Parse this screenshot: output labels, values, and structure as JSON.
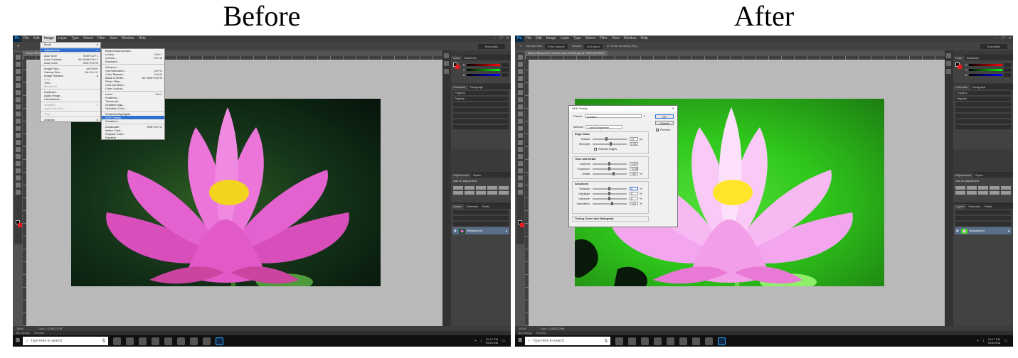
{
  "captions": {
    "before": "Before",
    "after": "After"
  },
  "app": {
    "logo": "Ps",
    "menus": [
      "File",
      "Edit",
      "Image",
      "Layer",
      "Type",
      "Select",
      "Filter",
      "View",
      "Window",
      "Help"
    ],
    "window_controls": [
      "–",
      "☐",
      "✕"
    ]
  },
  "before": {
    "doc_tab": "Banyo Banyo Arti",
    "options": {
      "workspace": "Essentials"
    },
    "image_menu": [
      {
        "label": "Mode",
        "submenu": true
      },
      {
        "sep": true
      },
      {
        "label": "Adjustments",
        "submenu": true,
        "highlight": true
      },
      {
        "sep": true
      },
      {
        "label": "Auto Tone",
        "shortcut": "Shift+Ctrl+L"
      },
      {
        "label": "Auto Contrast",
        "shortcut": "Alt+Shift+Ctrl+L"
      },
      {
        "label": "Auto Color",
        "shortcut": "Shift+Ctrl+B"
      },
      {
        "sep": true
      },
      {
        "label": "Image Size...",
        "shortcut": "Alt+Ctrl+I"
      },
      {
        "label": "Canvas Size...",
        "shortcut": "Alt+Ctrl+C"
      },
      {
        "label": "Image Rotation",
        "submenu": true
      },
      {
        "label": "Crop",
        "disabled": true
      },
      {
        "label": "Trim..."
      },
      {
        "label": "Reveal All",
        "disabled": true
      },
      {
        "sep": true
      },
      {
        "label": "Duplicate..."
      },
      {
        "label": "Apply Image..."
      },
      {
        "label": "Calculations..."
      },
      {
        "sep": true
      },
      {
        "label": "Variables",
        "submenu": true,
        "disabled": true
      },
      {
        "label": "Apply Data Set...",
        "disabled": true
      },
      {
        "sep": true
      },
      {
        "label": "Trap...",
        "disabled": true
      },
      {
        "sep": true
      },
      {
        "label": "Analysis",
        "submenu": true
      }
    ],
    "adjust_menu": [
      {
        "label": "Brightness/Contrast..."
      },
      {
        "label": "Levels...",
        "shortcut": "Ctrl+L"
      },
      {
        "label": "Curves...",
        "shortcut": "Ctrl+M"
      },
      {
        "label": "Exposure..."
      },
      {
        "sep": true
      },
      {
        "label": "Vibrance..."
      },
      {
        "label": "Hue/Saturation...",
        "shortcut": "Ctrl+U"
      },
      {
        "label": "Color Balance...",
        "shortcut": "Ctrl+B"
      },
      {
        "label": "Black & White...",
        "shortcut": "Alt+Shift+Ctrl+B"
      },
      {
        "label": "Photo Filter..."
      },
      {
        "label": "Channel Mixer..."
      },
      {
        "label": "Color Lookup..."
      },
      {
        "sep": true
      },
      {
        "label": "Invert",
        "shortcut": "Ctrl+I"
      },
      {
        "label": "Posterize..."
      },
      {
        "label": "Threshold..."
      },
      {
        "label": "Gradient Map..."
      },
      {
        "label": "Selective Color..."
      },
      {
        "sep": true
      },
      {
        "label": "Shadows/Highlights..."
      },
      {
        "label": "HDR Toning...",
        "highlight": true
      },
      {
        "label": "Variations..."
      },
      {
        "sep": true
      },
      {
        "label": "Desaturate",
        "shortcut": "Shift+Ctrl+U"
      },
      {
        "label": "Match Color..."
      },
      {
        "label": "Replace Color..."
      },
      {
        "label": "Equalize"
      }
    ],
    "status": {
      "zoom": "100%",
      "doc": "Doc: 1.37M/1.37M"
    }
  },
  "after": {
    "doc_tab": "Banyo Banyo Arti Verkom lotus overall.jpg @ 100% (RGB/8*)",
    "options": {
      "sample_size_label": "Sample Size:",
      "sample_size": "Point Sample",
      "sample_label": "Sample:",
      "sample": "All Layers",
      "show_ring": "Show Sampling Ring",
      "workspace": "Essentials"
    },
    "hdr": {
      "title": "HDR Toning",
      "preset_label": "Preset:",
      "preset": "Custom",
      "ok": "OK",
      "cancel": "Cancel",
      "preview": "Preview",
      "method_label": "Method:",
      "method": "Local Adaptation",
      "edge_glow": "Edge Glow",
      "radius_label": "Radius:",
      "radius": "17",
      "radius_unit": "px",
      "strength_label": "Strength:",
      "strength": "0.91",
      "smooth_edges": "Smooth Edges",
      "tone_detail": "Tone and Detail",
      "gamma_label": "Gamma:",
      "gamma": "1.00",
      "exposure_label": "Exposure:",
      "exposure": "+0.00",
      "detail_label": "Detail:",
      "detail": "+30",
      "detail_unit": "%",
      "advanced": "Advanced",
      "shadow_label": "Shadow:",
      "shadow": "0",
      "highlight_label": "Highlight:",
      "highlight": "0",
      "vibrance_label": "Vibrance:",
      "vibrance": "0",
      "saturation_label": "Saturation:",
      "saturation": "+20",
      "pct": "%",
      "toning_curve": "Toning Curve and Histogram"
    },
    "status": {
      "zoom": "100%",
      "doc": "Doc: 1.29M/1.29M"
    }
  },
  "panels": {
    "color_tabs": [
      "Color",
      "Swatches"
    ],
    "char_tabs": [
      "Character",
      "Paragraph"
    ],
    "font_family": "Poppins",
    "font_style": "Regular",
    "adj_tabs": [
      "Adjustments",
      "Styles"
    ],
    "adj_title": "Add an adjustment",
    "layer_tabs": [
      "Layers",
      "Channels",
      "Paths"
    ],
    "layer_name": "Background"
  },
  "taskbar": {
    "search_placeholder": "Type here to search",
    "time": "10:17 PM",
    "date": "9/19/2018"
  },
  "colors": {
    "highlight": "#2f6fcf",
    "brand": "#31a8ff"
  }
}
